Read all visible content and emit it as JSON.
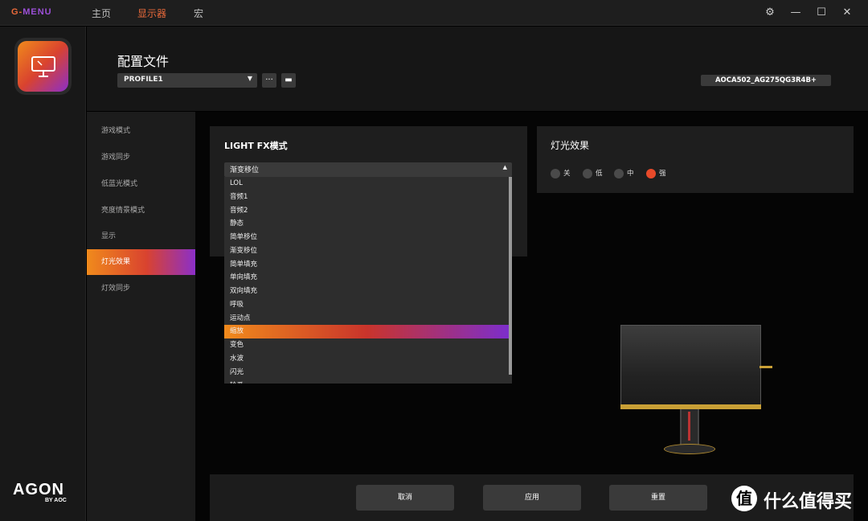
{
  "app": {
    "brand_a": "G-",
    "brand_b": "MENU",
    "nav": [
      "主页",
      "显示器",
      "宏"
    ],
    "active_nav": "显示器"
  },
  "window_controls": {
    "settings": "⚙",
    "minimize": "—",
    "maximize": "☐",
    "close": "✕"
  },
  "rail": {
    "logo_main": "AGON",
    "logo_sub": "BY AOC"
  },
  "header": {
    "title": "配置文件",
    "profile": "PROFILE1",
    "more_btn": "···",
    "save_btn": "▬",
    "device_id": "AOCA502_AG275QG3R4B+"
  },
  "sidebar": {
    "items": [
      "游戏模式",
      "游戏同步",
      "低蓝光模式",
      "亮度情景模式",
      "显示",
      "灯光效果",
      "灯效同步"
    ],
    "active": "灯光效果"
  },
  "lightfx": {
    "title": "LIGHT FX模式",
    "selected": "渐变移位",
    "options": [
      "LOL",
      "音频1",
      "音频2",
      "静态",
      "简单移位",
      "渐变移位",
      "简单填充",
      "单向填充",
      "双向填充",
      "呼吸",
      "运动点",
      "缩放",
      "变色",
      "水波",
      "闪光",
      "轮番"
    ],
    "highlighted": "缩放"
  },
  "effect": {
    "title": "灯光效果",
    "options": [
      "关",
      "低",
      "中",
      "强"
    ],
    "selected": "强",
    "accent_color": "#e84a2a"
  },
  "footer": {
    "cancel": "取消",
    "apply": "应用",
    "reset": "重置"
  },
  "watermark": {
    "logo": "值",
    "text": "什么值得买"
  }
}
